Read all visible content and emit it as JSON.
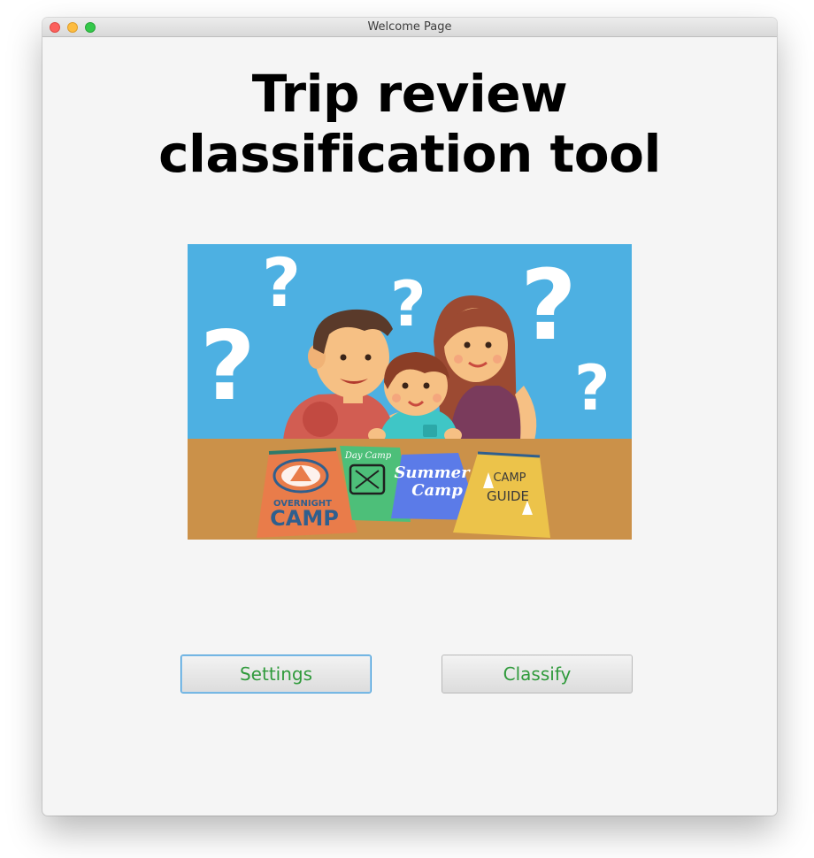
{
  "window": {
    "title": "Welcome Page"
  },
  "heading": {
    "line1": "Trip review",
    "line2": "classification tool"
  },
  "illustration": {
    "booklets": {
      "overnight_small": "OVERNIGHT",
      "overnight_big": "CAMP",
      "day_camp": "Day Camp",
      "summer_1": "Summer",
      "summer_2": "Camp",
      "guide_1": "CAMP",
      "guide_2": "GUIDE"
    }
  },
  "buttons": {
    "settings": "Settings",
    "classify": "Classify"
  },
  "colors": {
    "button_text": "#2f9a3b",
    "sky": "#4db0e2",
    "table": "#cb9149",
    "focus_ring": "#3d9ad8"
  }
}
